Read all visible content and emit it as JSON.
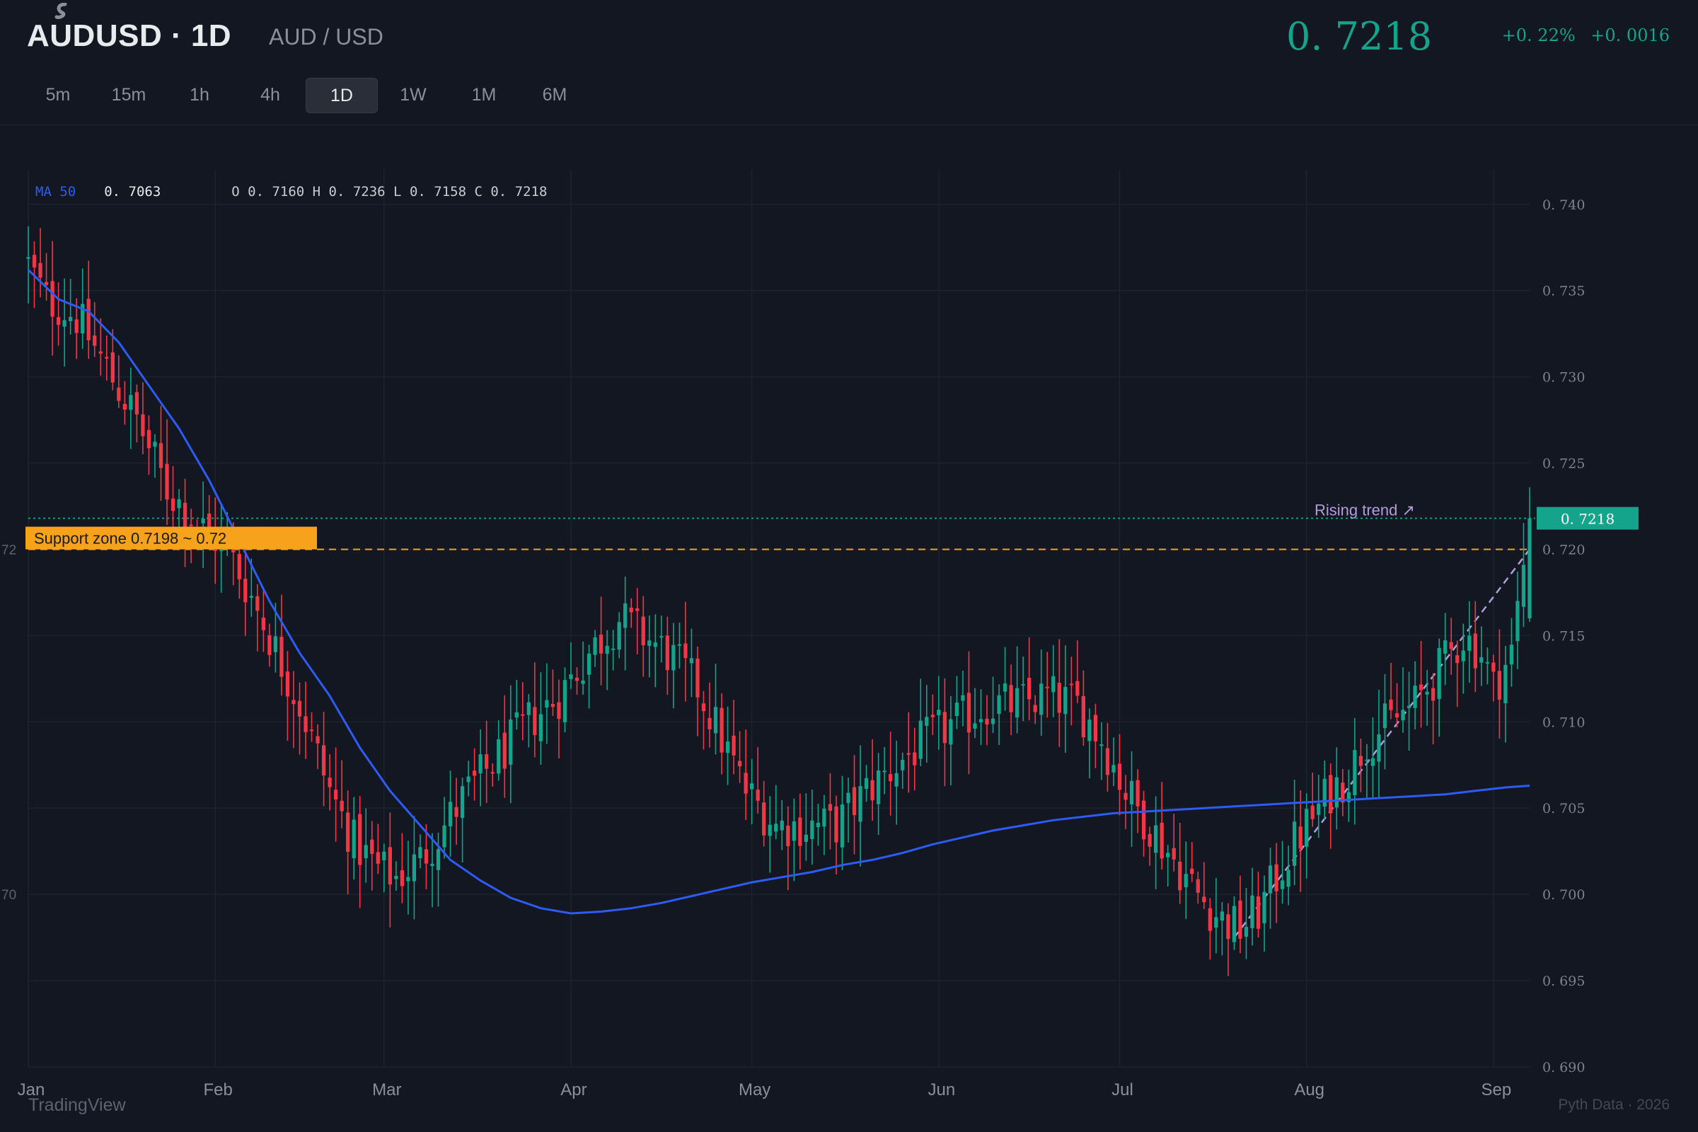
{
  "header": {
    "symbol": "AUDUSD · 1D",
    "pair": "AUD / USD",
    "price": "0. 7218",
    "change_pct": "+0. 22%",
    "change_abs": "+0. 0016"
  },
  "timeframes": [
    "5m",
    "15m",
    "1h",
    "4h",
    "1D",
    "1W",
    "1M",
    "6M"
  ],
  "active_timeframe": "1D",
  "legend": {
    "ma_label": "MA 50",
    "ma_value": "0. 7063",
    "ohlc": "O 0. 7160 H 0. 7236 L 0. 7158 C 0. 7218"
  },
  "annotations": {
    "support_label": "Support zone 0.7198 ~ 0.72",
    "trend_label": "Rising trend ↗",
    "last_price_tag": "0. 7218",
    "left_tick_upper": "72",
    "left_tick_lower": "70"
  },
  "watermark": "TradingView",
  "source": "Pyth Data · 2026",
  "colors": {
    "up": "#14a38b",
    "down": "#f23645",
    "ma": "#2d5cf5",
    "support": "#f7a21b",
    "trend": "#b39ddb",
    "background": "#131722"
  },
  "chart_data": {
    "type": "candlestick",
    "ylim": [
      0.69,
      0.742
    ],
    "yticks": [
      "0. 740",
      "0. 735",
      "0. 730",
      "0. 725",
      "0. 720",
      "0. 715",
      "0. 710",
      "0. 705",
      "0. 700",
      "0. 695",
      "0. 690"
    ],
    "ytick_values": [
      0.74,
      0.735,
      0.73,
      0.725,
      0.72,
      0.715,
      0.71,
      0.705,
      0.7,
      0.695,
      0.69
    ],
    "xtick_labels": [
      "Jan",
      "Feb",
      "Mar",
      "Apr",
      "May",
      "Jun",
      "Jul",
      "Aug",
      "Sep"
    ],
    "xtick_days": [
      0,
      31,
      59,
      90,
      120,
      151,
      181,
      212,
      243
    ],
    "days_total": 249,
    "close_anchors": [
      [
        0,
        0.7365
      ],
      [
        3,
        0.7345
      ],
      [
        8,
        0.7335
      ],
      [
        13,
        0.7305
      ],
      [
        18,
        0.7275
      ],
      [
        23,
        0.7235
      ],
      [
        28,
        0.7215
      ],
      [
        33,
        0.72
      ],
      [
        36,
        0.718
      ],
      [
        40,
        0.715
      ],
      [
        45,
        0.711
      ],
      [
        50,
        0.706
      ],
      [
        54,
        0.703
      ],
      [
        58,
        0.7015
      ],
      [
        61,
        0.701
      ],
      [
        65,
        0.702
      ],
      [
        69,
        0.704
      ],
      [
        73,
        0.706
      ],
      [
        78,
        0.708
      ],
      [
        83,
        0.71
      ],
      [
        88,
        0.7115
      ],
      [
        93,
        0.714
      ],
      [
        98,
        0.716
      ],
      [
        102,
        0.715
      ],
      [
        106,
        0.714
      ],
      [
        111,
        0.712
      ],
      [
        115,
        0.709
      ],
      [
        119,
        0.706
      ],
      [
        124,
        0.704
      ],
      [
        129,
        0.704
      ],
      [
        134,
        0.704
      ],
      [
        139,
        0.706
      ],
      [
        144,
        0.7075
      ],
      [
        149,
        0.709
      ],
      [
        154,
        0.71
      ],
      [
        159,
        0.711
      ],
      [
        164,
        0.711
      ],
      [
        169,
        0.7115
      ],
      [
        174,
        0.711
      ],
      [
        178,
        0.709
      ],
      [
        182,
        0.706
      ],
      [
        186,
        0.704
      ],
      [
        190,
        0.702
      ],
      [
        194,
        0.7
      ],
      [
        198,
        0.6985
      ],
      [
        201,
        0.698
      ],
      [
        204,
        0.699
      ],
      [
        207,
        0.701
      ],
      [
        210,
        0.703
      ],
      [
        213,
        0.7045
      ],
      [
        216,
        0.706
      ],
      [
        219,
        0.707
      ],
      [
        222,
        0.709
      ],
      [
        226,
        0.71
      ],
      [
        230,
        0.711
      ],
      [
        234,
        0.713
      ],
      [
        238,
        0.715
      ],
      [
        241,
        0.714
      ],
      [
        243,
        0.712
      ],
      [
        246,
        0.714
      ],
      [
        249,
        0.7218
      ]
    ],
    "ma50_points": [
      [
        0,
        0.7362
      ],
      [
        5,
        0.7345
      ],
      [
        10,
        0.7338
      ],
      [
        15,
        0.732
      ],
      [
        20,
        0.7295
      ],
      [
        25,
        0.727
      ],
      [
        30,
        0.724
      ],
      [
        35,
        0.7205
      ],
      [
        40,
        0.717
      ],
      [
        45,
        0.714
      ],
      [
        50,
        0.7115
      ],
      [
        55,
        0.7085
      ],
      [
        60,
        0.706
      ],
      [
        65,
        0.704
      ],
      [
        70,
        0.702
      ],
      [
        75,
        0.7008
      ],
      [
        80,
        0.6998
      ],
      [
        85,
        0.6992
      ],
      [
        90,
        0.6989
      ],
      [
        95,
        0.699
      ],
      [
        100,
        0.6992
      ],
      [
        105,
        0.6995
      ],
      [
        110,
        0.6999
      ],
      [
        115,
        0.7003
      ],
      [
        120,
        0.7007
      ],
      [
        125,
        0.701
      ],
      [
        130,
        0.7013
      ],
      [
        135,
        0.7017
      ],
      [
        140,
        0.702
      ],
      [
        145,
        0.7024
      ],
      [
        150,
        0.7029
      ],
      [
        155,
        0.7033
      ],
      [
        160,
        0.7037
      ],
      [
        165,
        0.704
      ],
      [
        170,
        0.7043
      ],
      [
        175,
        0.7045
      ],
      [
        180,
        0.7047
      ],
      [
        185,
        0.7048
      ],
      [
        190,
        0.7049
      ],
      [
        195,
        0.705
      ],
      [
        200,
        0.7051
      ],
      [
        205,
        0.7052
      ],
      [
        210,
        0.7053
      ],
      [
        215,
        0.7054
      ],
      [
        220,
        0.7055
      ],
      [
        225,
        0.7056
      ],
      [
        230,
        0.7057
      ],
      [
        235,
        0.7058
      ],
      [
        240,
        0.706
      ],
      [
        245,
        0.7062
      ],
      [
        249,
        0.7063
      ]
    ],
    "ma_label_y": 0.72,
    "last_price": 0.7218,
    "support_level": 0.72,
    "trend_line": [
      [
        200,
        0.6975
      ],
      [
        249,
        0.72
      ]
    ]
  }
}
